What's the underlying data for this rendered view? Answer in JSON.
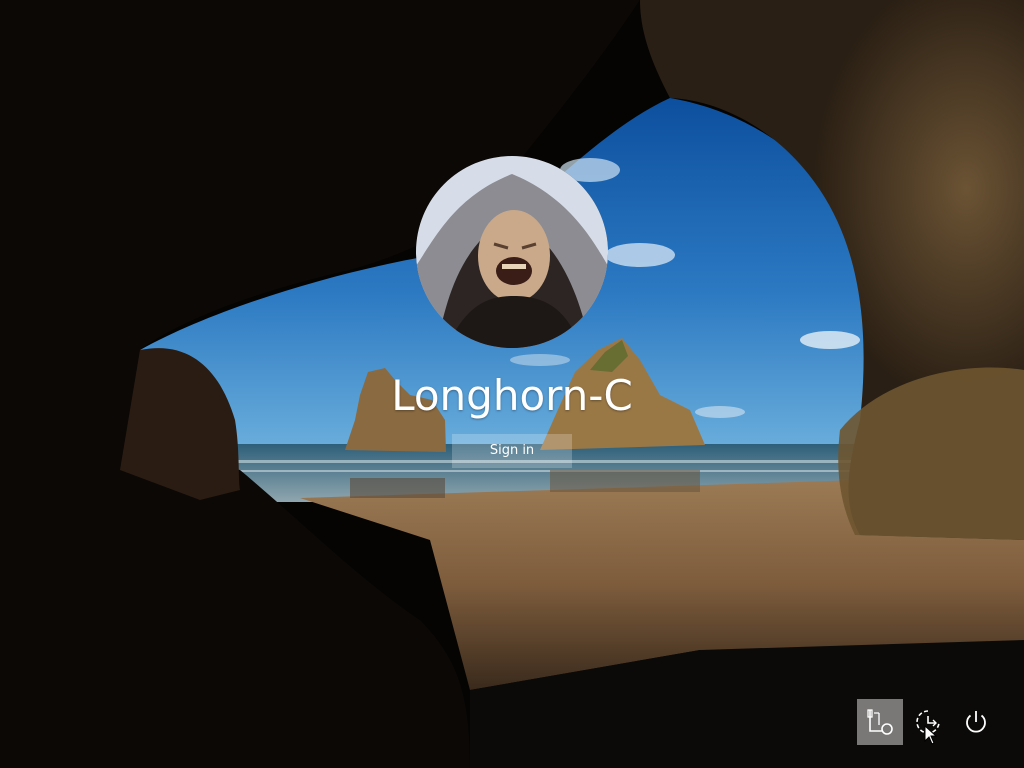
{
  "user": {
    "name": "Longhorn-C"
  },
  "signin": {
    "label": "Sign in"
  },
  "corner_buttons": [
    {
      "name": "network",
      "icon": "network-icon"
    },
    {
      "name": "ease-of-access",
      "icon": "ease-of-access-icon"
    },
    {
      "name": "power",
      "icon": "power-icon"
    }
  ],
  "colors": {
    "text": "#ffffff",
    "button_bg": "rgba(255,255,255,0.22)",
    "selected_corner_bg": "rgba(255,255,255,0.45)"
  }
}
